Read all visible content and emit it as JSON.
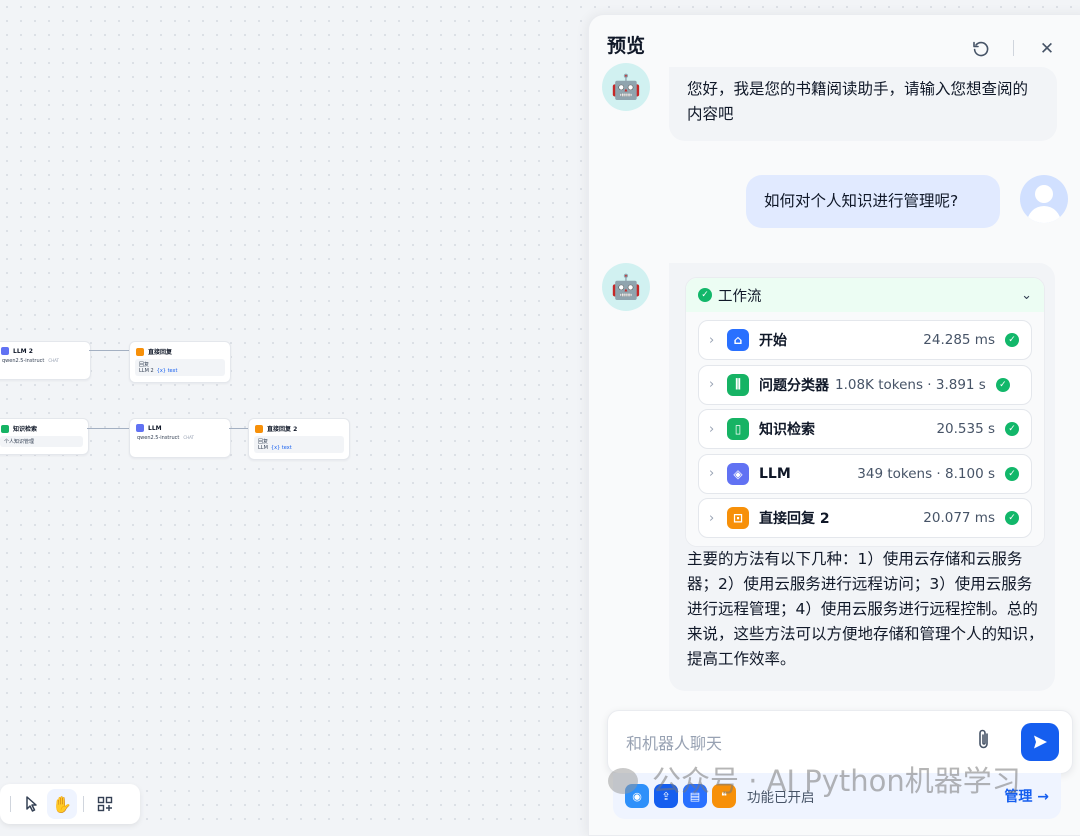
{
  "canvas": {
    "nodes": [
      {
        "title": "LLM 2",
        "model": "qwen2.5-instruct",
        "tag": "CHAT"
      },
      {
        "title": "直接回复",
        "field": "回复",
        "var_node": "LLM 2",
        "var_name": "{x} text"
      },
      {
        "title": "知识检索",
        "field": "个人知识管理"
      },
      {
        "title": "LLM",
        "model": "qwen2.5-instruct",
        "tag": "CHAT"
      },
      {
        "title": "直接回复 2",
        "field": "回复",
        "var_node": "LLM",
        "var_name": "{x} text"
      }
    ]
  },
  "toolbar": {
    "pointer_icon": "pointer-icon",
    "hand_icon": "hand-icon",
    "layout_icon": "layout-icon"
  },
  "preview": {
    "title": "预览",
    "restart_icon": "refresh-icon",
    "close_icon": "close-icon",
    "messages": {
      "greeting": "您好，我是您的书籍阅读助手，请输入您想查阅的内容吧",
      "question": "如何对个人知识进行管理呢?",
      "answer": "主要的方法有以下几种：1）使用云存储和云服务器；2）使用云服务进行远程访问；3）使用云服务进行远程管理；4）使用云服务进行远程控制。总的来说，这些方法可以方便地存储和管理个人的知识，提高工作效率。"
    },
    "workflow": {
      "title": "工作流",
      "steps": [
        {
          "name": "开始",
          "meta": "24.285 ms",
          "color": "#2970ff",
          "icon": "home-icon"
        },
        {
          "name": "问题分类器",
          "meta": "1.08K tokens · 3.891 s",
          "color": "#16b364",
          "icon": "classifier-icon"
        },
        {
          "name": "知识检索",
          "meta": "20.535 s",
          "color": "#16b364",
          "icon": "book-icon"
        },
        {
          "name": "LLM",
          "meta": "349 tokens · 8.100 s",
          "color": "#6172f3",
          "icon": "llm-icon"
        },
        {
          "name": "直接回复 2",
          "meta": "20.077 ms",
          "color": "#f79009",
          "icon": "reply-icon"
        }
      ]
    },
    "input": {
      "placeholder": "和机器人聊天"
    },
    "features": {
      "text": "功能已开启",
      "manage": "管理 →"
    }
  },
  "watermark": "公众号 · AI Python机器学习"
}
